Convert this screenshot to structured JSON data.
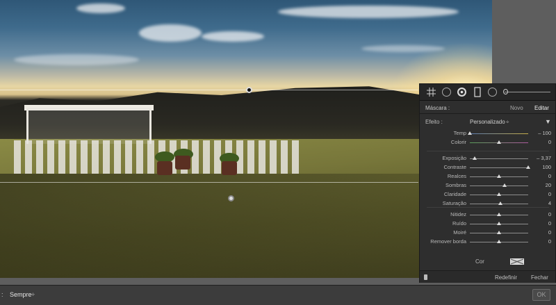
{
  "mask_panel": {
    "mask_label": "Máscara :",
    "new_label": "Novo",
    "edit_label": "Editar",
    "effect_label": "Efeito :",
    "effect_value": "Personalizado",
    "effect_dropdown_glyph": "÷",
    "collapse_glyph": "▼",
    "groups": [
      [
        {
          "label": "Temp",
          "value": "– 100",
          "position": 0.0
        },
        {
          "label": "Colorir",
          "value": "0",
          "position": 0.5
        }
      ],
      [
        {
          "label": "Exposição",
          "value": "– 3,37",
          "position": 0.08
        },
        {
          "label": "Contraste",
          "value": "100",
          "position": 1.0
        },
        {
          "label": "Realces",
          "value": "0",
          "position": 0.5
        },
        {
          "label": "Sombras",
          "value": "20",
          "position": 0.6
        },
        {
          "label": "Claridade",
          "value": "0",
          "position": 0.5
        },
        {
          "label": "Saturação",
          "value": "4",
          "position": 0.52
        }
      ],
      [
        {
          "label": "Nitidez",
          "value": "0",
          "position": 0.5
        },
        {
          "label": "Ruído",
          "value": "0",
          "position": 0.5
        },
        {
          "label": "Moiré",
          "value": "0",
          "position": 0.5
        },
        {
          "label": "Remover borda",
          "value": "0",
          "position": 0.5
        }
      ]
    ],
    "color_label": "Cor",
    "reset_label": "Redefinir",
    "close_label": "Fechar"
  },
  "toolbar": {
    "show_overlay_label": "Sempre",
    "ok_label": "OK"
  },
  "colors": {
    "panel_bg": "#2e2e2e",
    "panel_text": "#c9c9c9",
    "accent_white": "#dcdcdc"
  }
}
